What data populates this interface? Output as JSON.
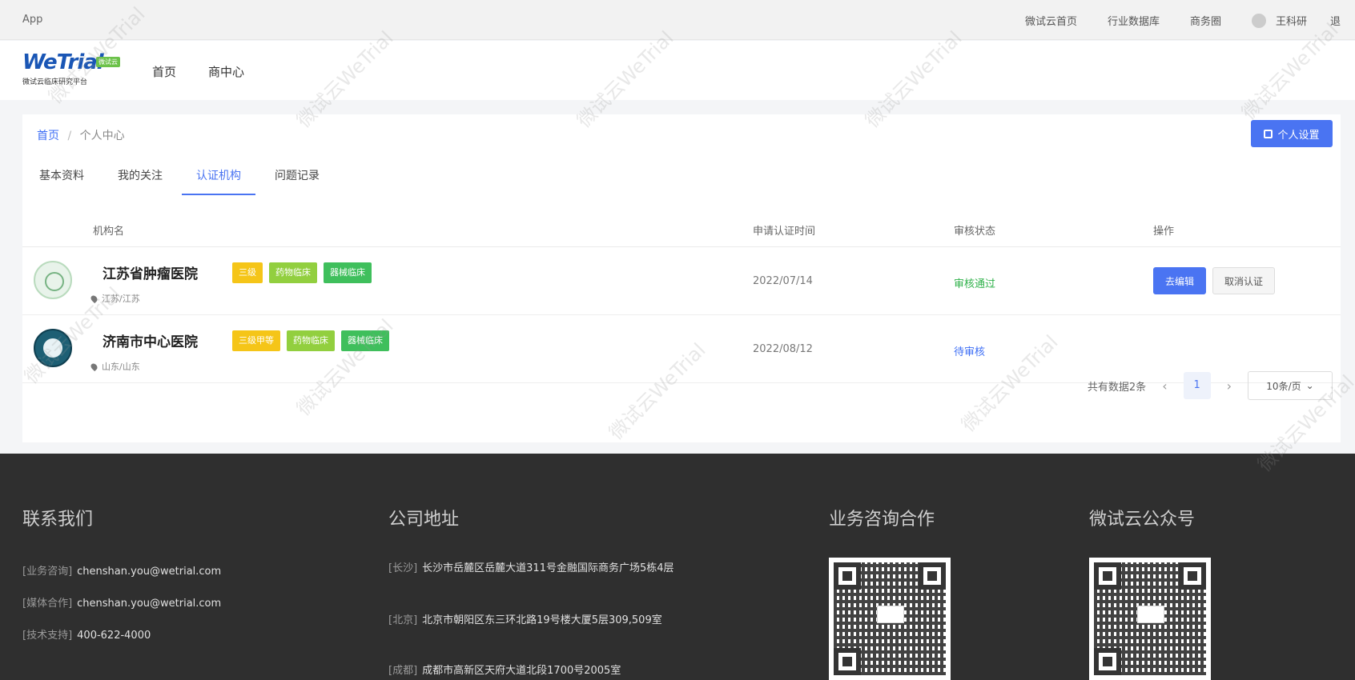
{
  "topbar": {
    "app_label": "App",
    "links": [
      "微试云首页",
      "行业数据库",
      "商务圈"
    ],
    "user_name": "王科研",
    "cut_text": "退"
  },
  "navbar": {
    "logo_text": "WeTrial",
    "logo_sub": "微试云临床研究平台",
    "logo_badge": "微试云",
    "items": [
      "首页",
      "商中心"
    ]
  },
  "breadcrumb": {
    "home": "首页",
    "sep": "/",
    "current": "个人中心"
  },
  "settings_button": "个人设置",
  "tabs": [
    "基本资料",
    "我的关注",
    "认证机构",
    "问题记录"
  ],
  "table": {
    "headers": [
      "机构名",
      "申请认证时间",
      "审核状态",
      "操作"
    ],
    "rows": [
      {
        "name": "江苏省肿瘤医院",
        "tags": [
          "三级",
          "药物临床",
          "器械临床"
        ],
        "location": "江苏/江苏",
        "date": "2022/07/14",
        "status": "审核通过",
        "ops": [
          "去编辑",
          "取消认证"
        ]
      },
      {
        "name": "济南市中心医院",
        "tags": [
          "三级甲等",
          "药物临床",
          "器械临床"
        ],
        "location": "山东/山东",
        "date": "2022/08/12",
        "status": "待审核",
        "ops": []
      }
    ]
  },
  "pager": {
    "total": "共有数据2条",
    "prev": "‹",
    "current": "1",
    "next": "›",
    "size": "10条/页"
  },
  "footer": {
    "contact": {
      "title": "联系我们",
      "lines": [
        {
          "label": "[业务咨询]",
          "value": "chenshan.you@wetrial.com"
        },
        {
          "label": "[媒体合作]",
          "value": "chenshan.you@wetrial.com"
        },
        {
          "label": "[技术支持]",
          "value": "400-622-4000"
        }
      ]
    },
    "address": {
      "title": "公司地址",
      "lines": [
        {
          "label": "[长沙]",
          "value": "长沙市岳麓区岳麓大道311号金融国际商务广场5栋4层"
        },
        {
          "label": "[北京]",
          "value": "北京市朝阳区东三环北路19号楼大厦5层309,509室"
        },
        {
          "label": "[成都]",
          "value": "成都市高新区天府大道北段1700号2005室"
        }
      ]
    },
    "business_title": "业务咨询合作",
    "wechat_title": "微试云公众号"
  },
  "watermark_text": "微试云WeTrial"
}
